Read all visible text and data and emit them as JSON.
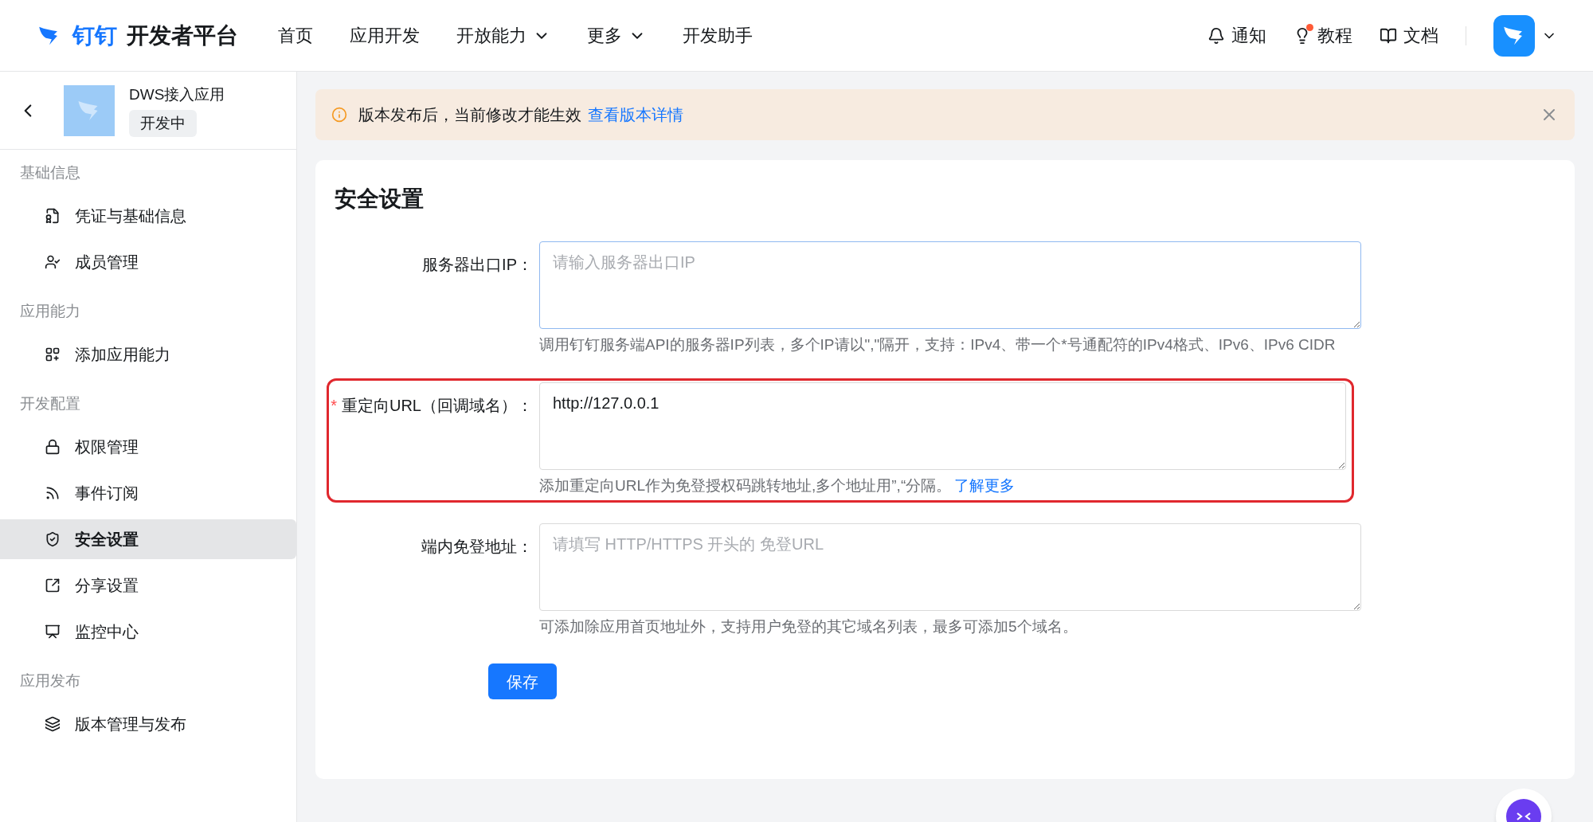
{
  "header": {
    "logo_text": "钉钉",
    "title": "开发者平台",
    "nav": [
      {
        "label": "首页",
        "dropdown": false
      },
      {
        "label": "应用开发",
        "dropdown": false
      },
      {
        "label": "开放能力",
        "dropdown": true
      },
      {
        "label": "更多",
        "dropdown": true
      },
      {
        "label": "开发助手",
        "dropdown": false
      }
    ],
    "actions": [
      {
        "label": "通知",
        "kind": "bell",
        "dot": false
      },
      {
        "label": "教程",
        "kind": "bulb",
        "dot": true
      },
      {
        "label": "文档",
        "kind": "book",
        "dot": false
      }
    ]
  },
  "sidebar": {
    "app": {
      "name": "DWS接入应用",
      "status": "开发中"
    },
    "sections": [
      {
        "title": "基础信息",
        "items": [
          {
            "label": "凭证与基础信息",
            "selected": false
          },
          {
            "label": "成员管理",
            "selected": false
          }
        ]
      },
      {
        "title": "应用能力",
        "items": [
          {
            "label": "添加应用能力",
            "selected": false
          }
        ]
      },
      {
        "title": "开发配置",
        "items": [
          {
            "label": "权限管理",
            "selected": false
          },
          {
            "label": "事件订阅",
            "selected": false
          },
          {
            "label": "安全设置",
            "selected": true
          },
          {
            "label": "分享设置",
            "selected": false
          },
          {
            "label": "监控中心",
            "selected": false
          }
        ]
      },
      {
        "title": "应用发布",
        "items": [
          {
            "label": "版本管理与发布",
            "selected": false
          }
        ]
      }
    ]
  },
  "alert": {
    "text": "版本发布后，当前修改才能生效",
    "link": "查看版本详情"
  },
  "page": {
    "title": "安全设置",
    "fields": [
      {
        "label": "服务器出口IP：",
        "placeholder": "请输入服务器出口IP",
        "help": "调用钉钉服务端API的服务器IP列表，多个IP请以\",\"隔开，支持：IPv4、带一个*号通配符的IPv4格式、IPv6、IPv6 CIDR",
        "highlighted": false
      },
      {
        "label": "重定向URL（回调域名）：",
        "required_mark": "*",
        "value": "http://127.0.0.1",
        "help": "添加重定向URL作为免登授权码跳转地址,多个地址用”,“分隔。",
        "help_link": "了解更多",
        "highlighted": true
      },
      {
        "label": "端内免登地址：",
        "placeholder": "请填写 HTTP/HTTPS 开头的 免登URL",
        "help": "可添加除应用首页地址外，支持用户免登的其它域名列表，最多可添加5个域名。",
        "highlighted": false
      }
    ],
    "save": "保存"
  }
}
